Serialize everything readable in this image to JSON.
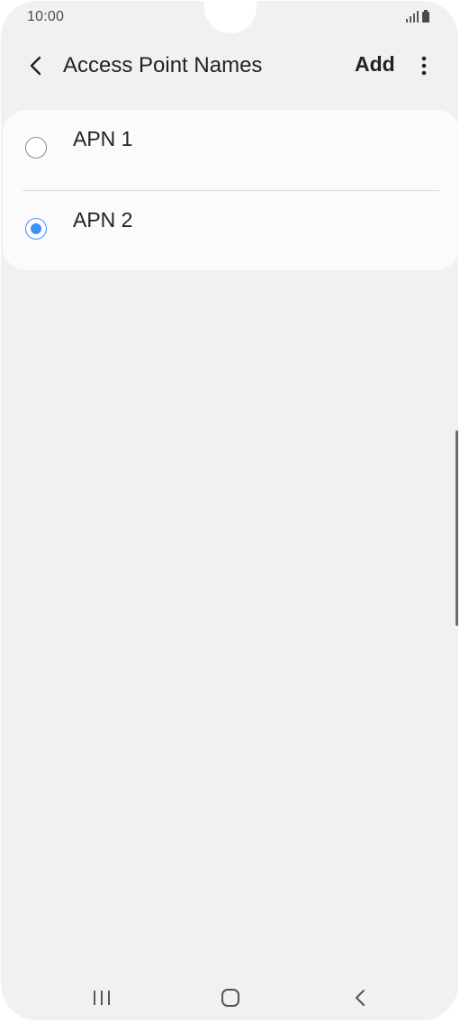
{
  "status_bar": {
    "time": "10:00",
    "icons": [
      "signal-icon",
      "battery-icon"
    ]
  },
  "header": {
    "back_icon": "chevron-left-icon",
    "title": "Access Point Names",
    "add_label": "Add",
    "more_icon": "more-vertical-icon"
  },
  "apn_list": {
    "items": [
      {
        "label": "APN 1",
        "selected": false
      },
      {
        "label": "APN 2",
        "selected": true
      }
    ]
  },
  "nav_bar": {
    "icons": [
      "recents-icon",
      "home-icon",
      "back-icon"
    ]
  },
  "colors": {
    "background": "#f1f1f1",
    "card": "#fbfbfb",
    "accent": "#3e91f7",
    "text": "#222222"
  }
}
